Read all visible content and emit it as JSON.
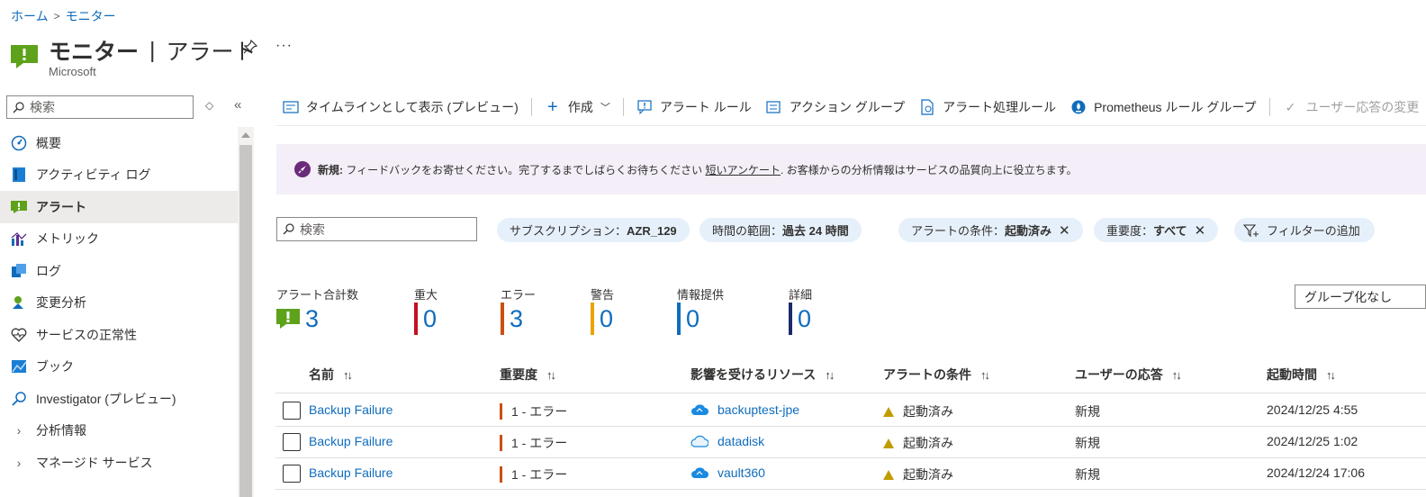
{
  "breadcrumb": {
    "home": "ホーム",
    "sep": ">",
    "current": "モニター"
  },
  "header": {
    "title_main": "モニター",
    "pipe": "|",
    "title_sub": "アラート",
    "subtitle": "Microsoft",
    "pin_icon": "pin-icon",
    "more": "···"
  },
  "sidebar": {
    "search_placeholder": "検索",
    "items": [
      {
        "label": "概要",
        "icon": "gauge-icon"
      },
      {
        "label": "アクティビティ ログ",
        "icon": "log-book-icon"
      },
      {
        "label": "アラート",
        "icon": "alert-icon",
        "active": true
      },
      {
        "label": "メトリック",
        "icon": "chart-icon"
      },
      {
        "label": "ログ",
        "icon": "logs-icon"
      },
      {
        "label": "変更分析",
        "icon": "change-icon"
      },
      {
        "label": "サービスの正常性",
        "icon": "heart-icon"
      },
      {
        "label": "ブック",
        "icon": "workbook-icon"
      },
      {
        "label": "Investigator (プレビュー)",
        "icon": "search-icon"
      },
      {
        "label": "分析情報",
        "icon": "chevron-right-icon"
      },
      {
        "label": "マネージド サービス",
        "icon": "chevron-right-icon"
      }
    ]
  },
  "toolbar": {
    "timeline": "タイムラインとして表示 (プレビュー)",
    "create": "作成",
    "alert_rules": "アラート ルール",
    "action_groups": "アクション グループ",
    "processing_rules": "アラート処理ルール",
    "prometheus": "Prometheus ルール グループ",
    "change_response": "ユーザー応答の変更",
    "more": "···"
  },
  "banner": {
    "new_label": "新規:",
    "text_before": "フィードバックをお寄せください。完了するまでしばらくお待ちください",
    "survey_link": "短いアンケート",
    "text_after": ". お客様からの分析情報はサービスの品質向上に役立ちます。"
  },
  "filters": {
    "search_placeholder": "検索",
    "subscription_label": "サブスクリプション：",
    "subscription_value": "AZR_129",
    "time_label": "時間の範囲：",
    "time_value": "過去 24 時間",
    "condition_label": "アラートの条件：",
    "condition_value": "起動済み",
    "severity_label": "重要度：",
    "severity_value": "すべて",
    "add_filter": "フィルターの追加"
  },
  "summary": {
    "total_label": "アラート合計数",
    "total": "3",
    "critical_label": "重大",
    "critical": "0",
    "error_label": "エラー",
    "error": "3",
    "warning_label": "警告",
    "warning": "0",
    "info_label": "情報提供",
    "info": "0",
    "verbose_label": "詳細",
    "verbose": "0",
    "colors": {
      "critical": "#c50f1f",
      "error": "#ca5010",
      "warning": "#eaa300",
      "info": "#0f6cbd",
      "verbose": "#1b2a6b"
    },
    "groupby": "グループ化なし"
  },
  "table": {
    "columns": [
      "名前",
      "重要度",
      "影響を受けるリソース",
      "アラートの条件",
      "ユーザーの応答",
      "起動時間"
    ],
    "sort_glyph": "↑↓",
    "rows": [
      {
        "name": "Backup Failure",
        "severity": "1 - エラー",
        "resource": "backuptest-jpe",
        "condition": "起動済み",
        "response": "新規",
        "fired": "2024/12/25 4:55"
      },
      {
        "name": "Backup Failure",
        "severity": "1 - エラー",
        "resource": "datadisk",
        "condition": "起動済み",
        "response": "新規",
        "fired": "2024/12/25 1:02"
      },
      {
        "name": "Backup Failure",
        "severity": "1 - エラー",
        "resource": "vault360",
        "condition": "起動済み",
        "response": "新規",
        "fired": "2024/12/24 17:06"
      }
    ]
  }
}
